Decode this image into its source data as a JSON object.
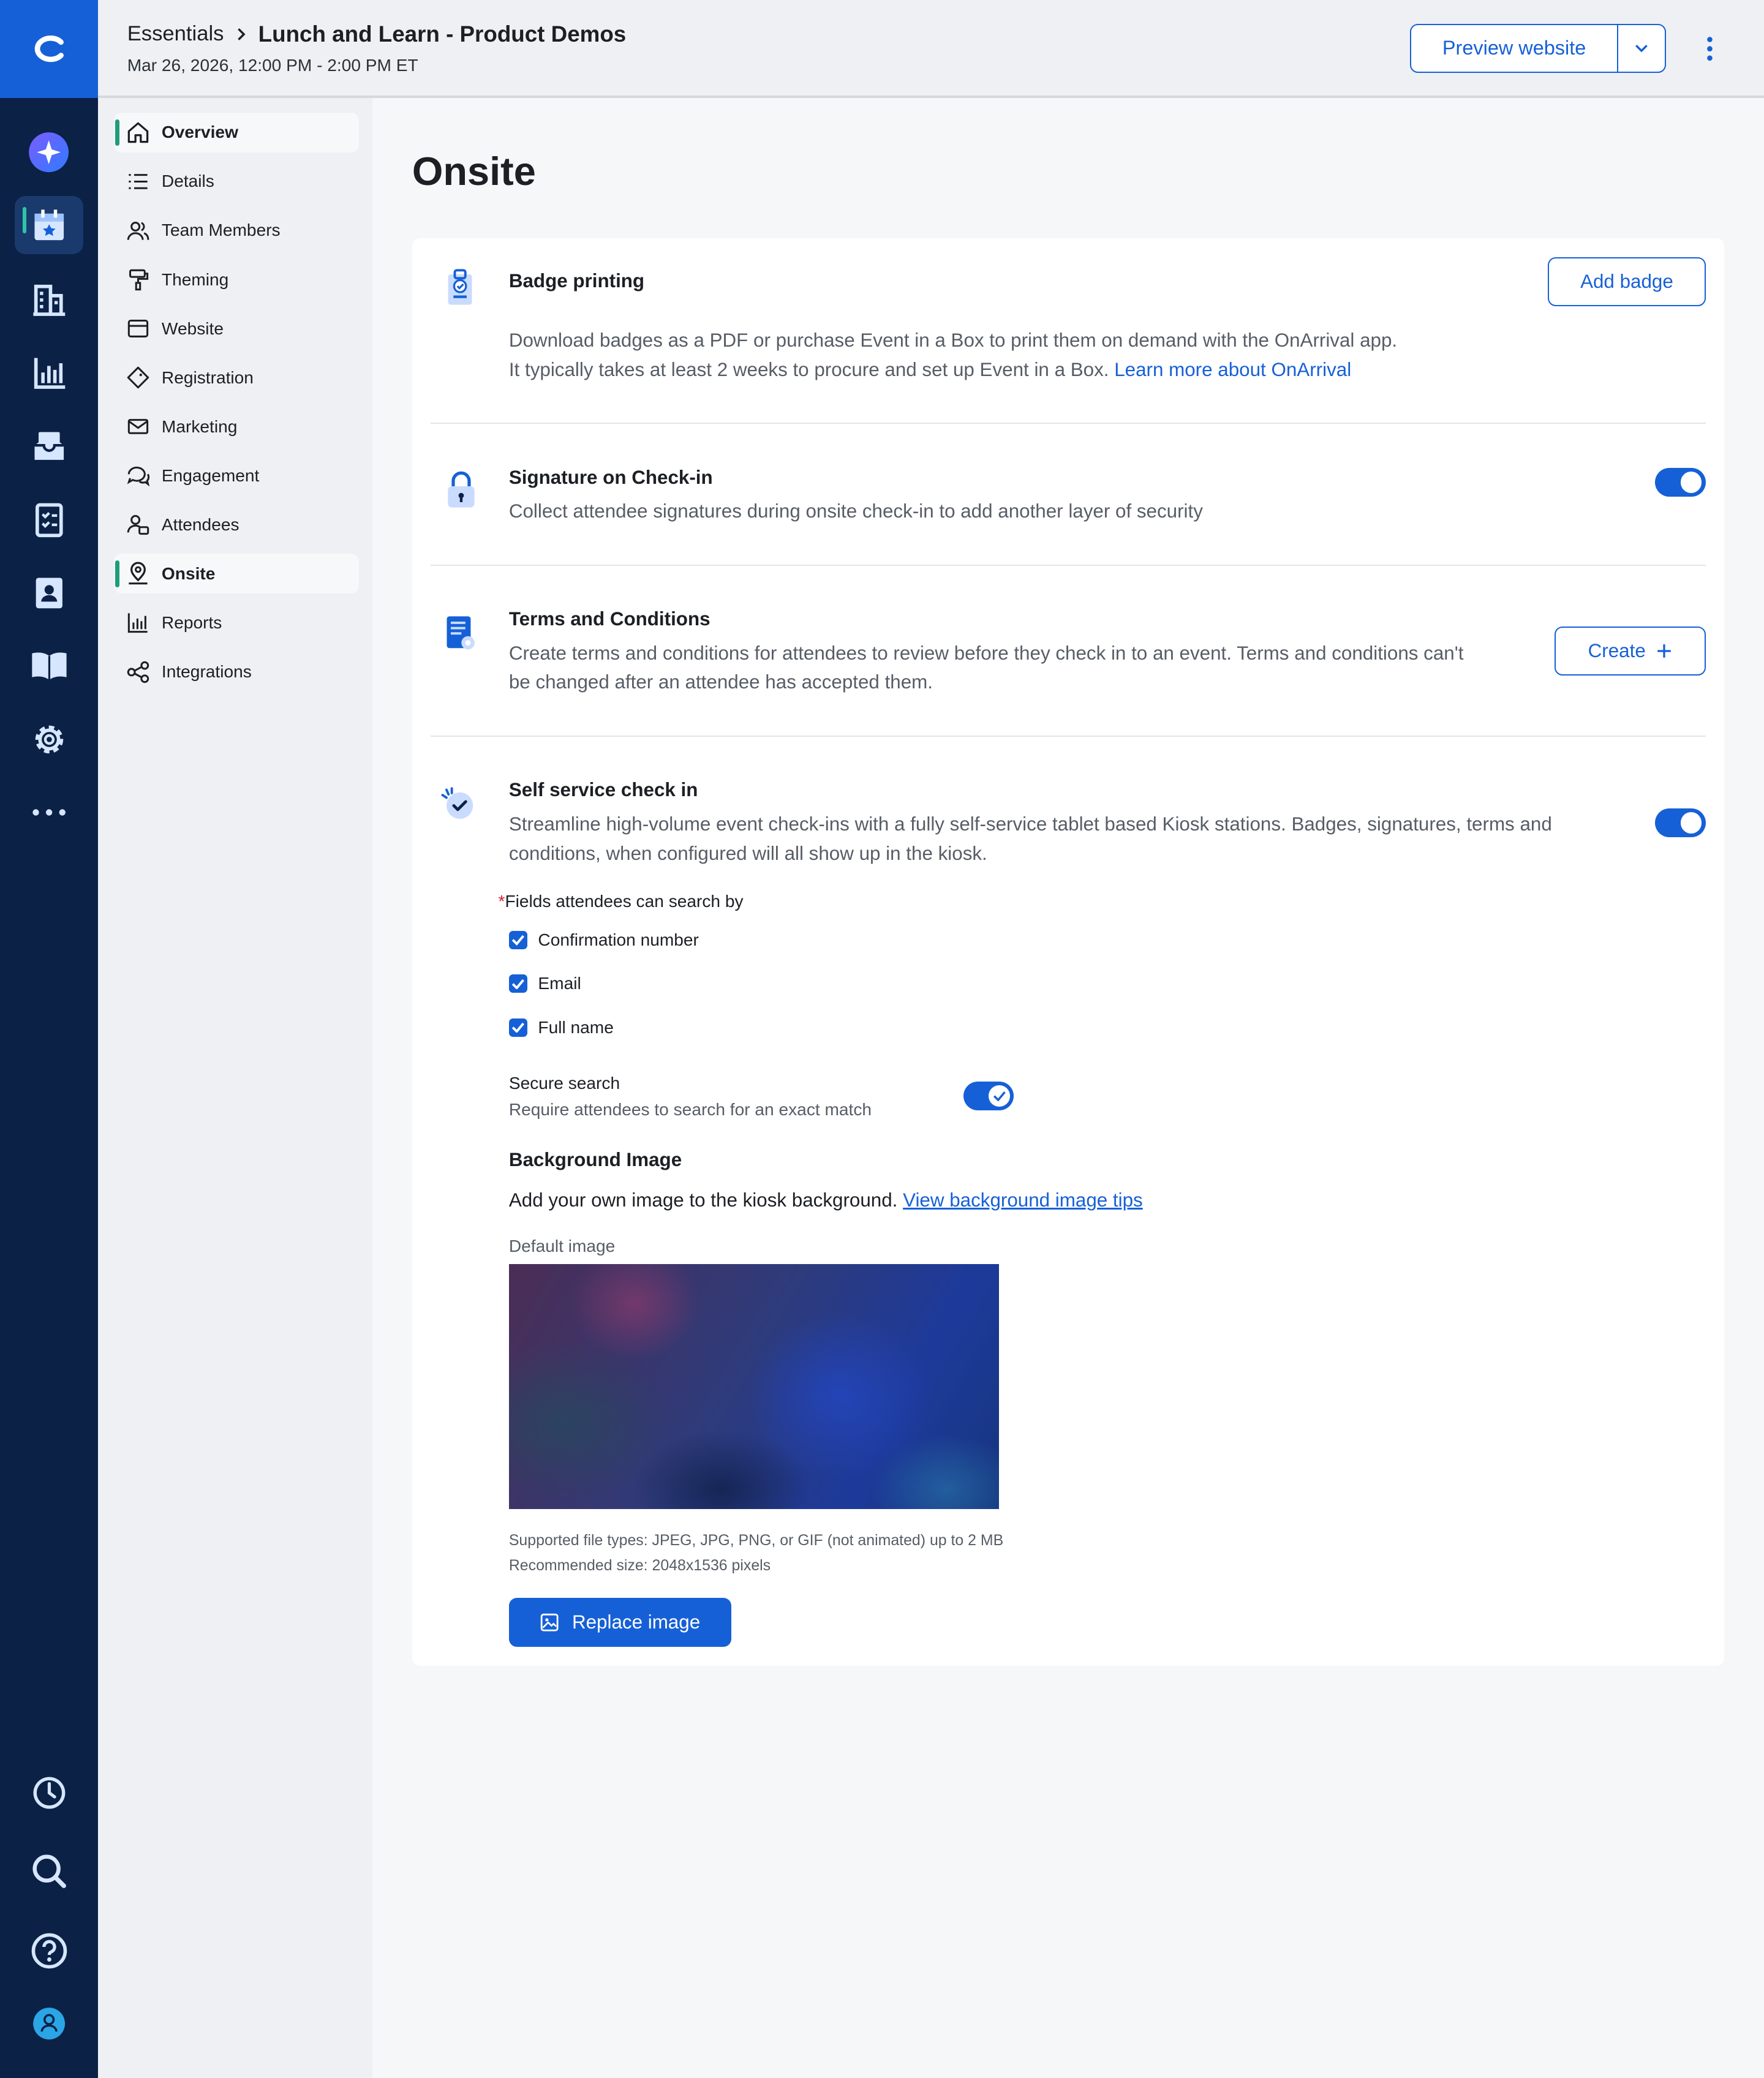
{
  "header": {
    "breadcrumb_parent": "Essentials",
    "breadcrumb_current": "Lunch and Learn - Product Demos",
    "event_date": "Mar 26, 2026, 12:00 PM - 2:00 PM ET",
    "preview_label": "Preview website"
  },
  "rail": {
    "icons": [
      "logo-icon",
      "ai-assistant-icon",
      "calendar-icon",
      "building-icon",
      "chart-icon",
      "inbox-icon",
      "checklist-icon",
      "contact-card-icon",
      "book-icon",
      "gear-icon",
      "more-icon",
      "clock-icon",
      "search-icon",
      "help-icon",
      "user-icon"
    ]
  },
  "sidenav": {
    "items": [
      {
        "label": "Overview",
        "icon": "home-icon"
      },
      {
        "label": "Details",
        "icon": "list-icon"
      },
      {
        "label": "Team Members",
        "icon": "people-icon"
      },
      {
        "label": "Theming",
        "icon": "paint-roller-icon"
      },
      {
        "label": "Website",
        "icon": "browser-icon"
      },
      {
        "label": "Registration",
        "icon": "ticket-icon"
      },
      {
        "label": "Marketing",
        "icon": "mail-icon"
      },
      {
        "label": "Engagement",
        "icon": "chat-icon"
      },
      {
        "label": "Attendees",
        "icon": "attendees-icon"
      },
      {
        "label": "Onsite",
        "icon": "location-pin-icon"
      },
      {
        "label": "Reports",
        "icon": "bar-chart-icon"
      },
      {
        "label": "Integrations",
        "icon": "share-nodes-icon"
      }
    ]
  },
  "main": {
    "title": "Onsite",
    "badge": {
      "title": "Badge printing",
      "desc_line1": "Download badges as a PDF or purchase Event in a Box to print them on demand with the OnArrival app.",
      "desc_line2": "It typically takes at least 2 weeks to procure and set up Event in a Box.",
      "link": "Learn more about OnArrival",
      "button": "Add badge"
    },
    "signature": {
      "title": "Signature on Check-in",
      "desc": "Collect attendee signatures during onsite check-in to add another layer of security",
      "enabled": true
    },
    "terms": {
      "title": "Terms and Conditions",
      "desc_line1": "Create terms and conditions for attendees to review before they check in to an event. Terms and conditions can't",
      "desc_line2": "be changed after an attendee has accepted them.",
      "button": "Create"
    },
    "selfservice": {
      "title": "Self service check in",
      "desc_line1": "Streamline high-volume event check-ins with a fully self-service tablet based Kiosk stations. Badges, signatures, terms and",
      "desc_line2": "conditions, when configured will all show up in the kiosk.",
      "enabled": true,
      "required_mark": "*",
      "fields_label": "Fields attendees can search by",
      "fields": [
        {
          "label": "Confirmation number",
          "checked": true
        },
        {
          "label": "Email",
          "checked": true
        },
        {
          "label": "Full name",
          "checked": true
        }
      ],
      "secure_title": "Secure search",
      "secure_desc": "Require attendees to search for an exact match",
      "secure_enabled": true,
      "bg_title": "Background Image",
      "bg_desc": "Add your own image to the kiosk background.",
      "bg_link": "View background image tips",
      "default_label": "Default image",
      "file_types": "Supported file types: JPEG, JPG, PNG, or GIF (not animated) up to 2 MB",
      "recommended": "Recommended size: 2048x1536 pixels",
      "replace_button": "Replace image"
    }
  },
  "colors": {
    "accent": "#1660d7",
    "rail": "#0b2145",
    "active_marker": "#2ec4a5"
  }
}
